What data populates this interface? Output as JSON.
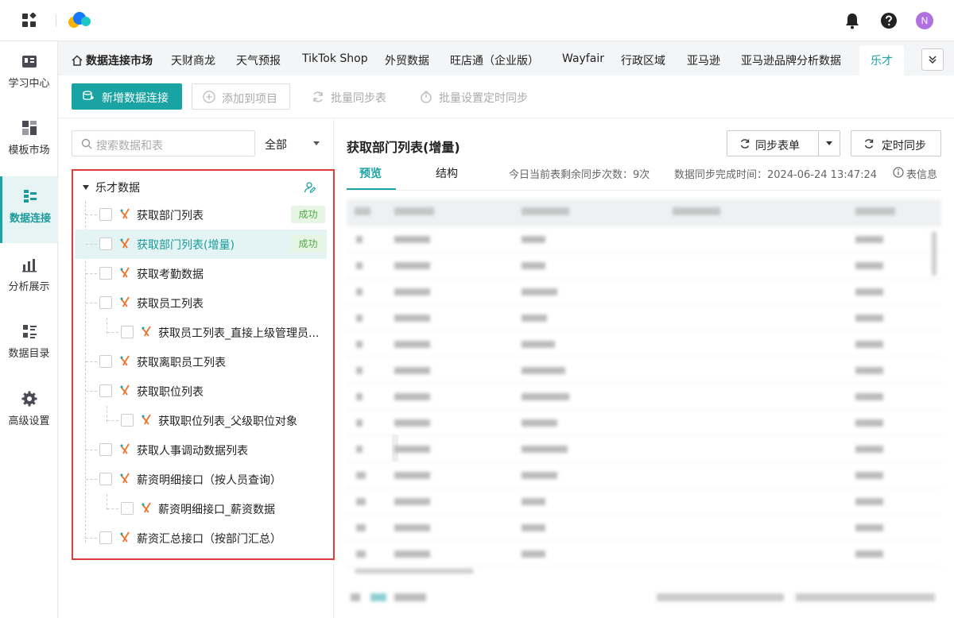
{
  "topbar": {
    "avatar_letter": "N"
  },
  "sidebar": {
    "items": [
      {
        "label": "学习中心",
        "icon": "book-icon"
      },
      {
        "label": "模板市场",
        "icon": "template-icon"
      },
      {
        "label": "数据连接",
        "icon": "data-connect-icon",
        "active": true
      },
      {
        "label": "分析展示",
        "icon": "chart-icon"
      },
      {
        "label": "数据目录",
        "icon": "catalog-icon"
      },
      {
        "label": "高级设置",
        "icon": "gear-icon"
      }
    ]
  },
  "tabs": {
    "items": [
      "数据连接市场",
      "天财商龙",
      "天气预报",
      "TikTok Shop",
      "外贸数据",
      "旺店通（企业版）",
      "Wayfair",
      "行政区域",
      "亚马逊",
      "亚马逊品牌分析数据",
      "乐才"
    ],
    "active": "乐才"
  },
  "toolbar": {
    "new_connection": "新增数据连接",
    "add_to_project": "添加到项目",
    "batch_sync": "批量同步表",
    "batch_schedule": "批量设置定时同步"
  },
  "left": {
    "search_placeholder": "搜索数据和表",
    "filter_value": "全部",
    "root_label": "乐才数据",
    "tree": [
      {
        "label": "获取部门列表",
        "level": 1,
        "status": "成功"
      },
      {
        "label": "获取部门列表(增量)",
        "level": 1,
        "status": "成功",
        "selected": true
      },
      {
        "label": "获取考勤数据",
        "level": 1
      },
      {
        "label": "获取员工列表",
        "level": 1
      },
      {
        "label": "获取员工列表_直接上级管理员...",
        "level": 2
      },
      {
        "label": "获取离职员工列表",
        "level": 1
      },
      {
        "label": "获取职位列表",
        "level": 1
      },
      {
        "label": "获取职位列表_父级职位对象",
        "level": 2
      },
      {
        "label": "获取人事调动数据列表",
        "level": 1
      },
      {
        "label": "薪资明细接口（按人员查询）",
        "level": 1
      },
      {
        "label": "薪资明细接口_薪资数据",
        "level": 2
      },
      {
        "label": "薪资汇总接口（按部门汇总）",
        "level": 1
      }
    ]
  },
  "right": {
    "title": "获取部门列表(增量)",
    "sync_button": "同步表单",
    "timer_button": "定时同步",
    "tab_preview": "预览",
    "tab_structure": "结构",
    "remaining_sync": "今日当前表剩余同步次数：9次",
    "sync_time": "数据同步完成时间：2024-06-24 13:47:24",
    "table_info": "表信息"
  },
  "colors": {
    "accent": "#1aa3a3",
    "success_bg": "#e7f6e4",
    "success_text": "#4daa45",
    "highlight_border": "#e03c3c"
  }
}
